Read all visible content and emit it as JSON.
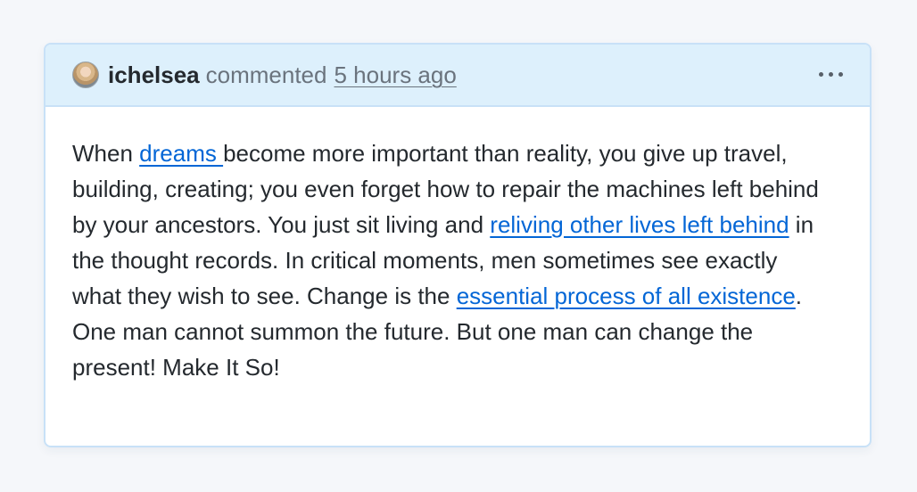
{
  "comment": {
    "author": "ichelsea",
    "action": "commented",
    "timestamp": "5 hours ago",
    "more_icon": "ellipsis-horizontal-icon",
    "body": {
      "t1": "When ",
      "link1": "dreams ",
      "t2": "become more important than reality, you give up travel, building, creating; you even forget how to repair the machines left behind by your ancestors. You just sit living and ",
      "link2": "reliving other lives left behind",
      "t3": " in the thought records. In critical moments, men sometimes see exactly what they wish to see. Change is the ",
      "link3": "essential process of all existence",
      "t4": ". One man cannot summon the future. But one man can change the present! Make It So!"
    }
  },
  "colors": {
    "header_background": "#ddf0fc",
    "border": "#c8e1f7",
    "link": "#0366d6",
    "text": "#24292e",
    "muted_text": "#6a737d"
  }
}
